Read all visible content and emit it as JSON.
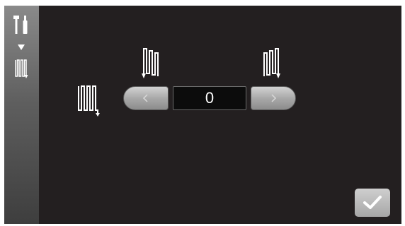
{
  "icons": {
    "tools": "tools-icon",
    "menu_arrow": "triangle-down-icon",
    "side_pattern": "pattern-down-icon",
    "pattern_left": "pattern-down-icon",
    "pattern_up_left": "pattern-down-icon",
    "pattern_up_right": "pattern-down-icon",
    "decrement": "chevron-left-icon",
    "increment": "chevron-right-icon",
    "confirm": "checkmark-icon"
  },
  "stepper": {
    "value": "0"
  },
  "colors": {
    "background": "#231f20",
    "icon": "#ffffff",
    "button": "#a9a9a9"
  }
}
